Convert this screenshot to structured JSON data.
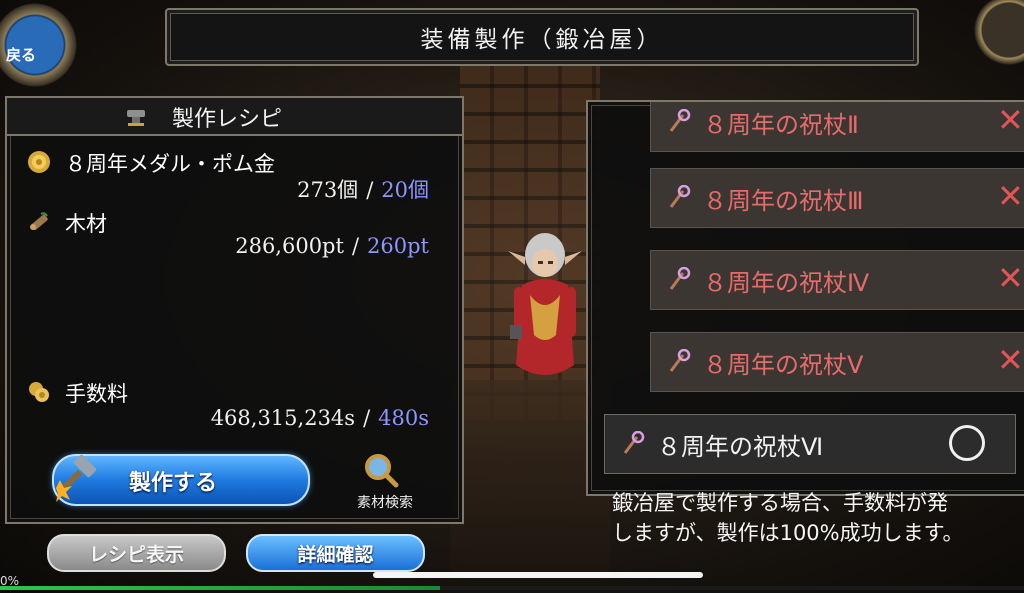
{
  "title": "装備製作（鍛冶屋）",
  "back_button": {
    "label": "戻る",
    "icon": "back-orb-icon"
  },
  "recipe": {
    "header": "製作レシピ",
    "materials": [
      {
        "name": "８周年メダル・ポム金",
        "have": "273個",
        "need": "20個",
        "icon": "medal-coin-icon"
      },
      {
        "name": "木材",
        "have": "286,600pt",
        "need": "260pt",
        "icon": "wood-icon"
      },
      {
        "name": "手数料",
        "have": "468,315,234s",
        "need": "480s",
        "icon": "coins-icon"
      }
    ],
    "separator": "/",
    "craft_button": "製作する",
    "search_label": "素材検索"
  },
  "bottom_buttons": {
    "recipe_view": "レシピ表示",
    "details": "詳細確認"
  },
  "items": [
    {
      "name": "８周年の祝杖Ⅱ",
      "mark": "✕"
    },
    {
      "name": "８周年の祝杖Ⅲ",
      "mark": "✕"
    },
    {
      "name": "８周年の祝杖Ⅳ",
      "mark": "✕"
    },
    {
      "name": "８周年の祝杖Ⅴ",
      "mark": "✕"
    }
  ],
  "selected_item": {
    "name": "８周年の祝杖Ⅵ",
    "mark": "○"
  },
  "description": {
    "line1": "鍛冶屋で製作する場合、手数料が発",
    "line2": "しますが、製作は100%成功します。"
  },
  "progress": {
    "label": "0%",
    "fraction": 0.43
  },
  "colors": {
    "need": "#8d96ff",
    "unavailable": "#e66b6b",
    "accent": "#1f7ae0"
  }
}
